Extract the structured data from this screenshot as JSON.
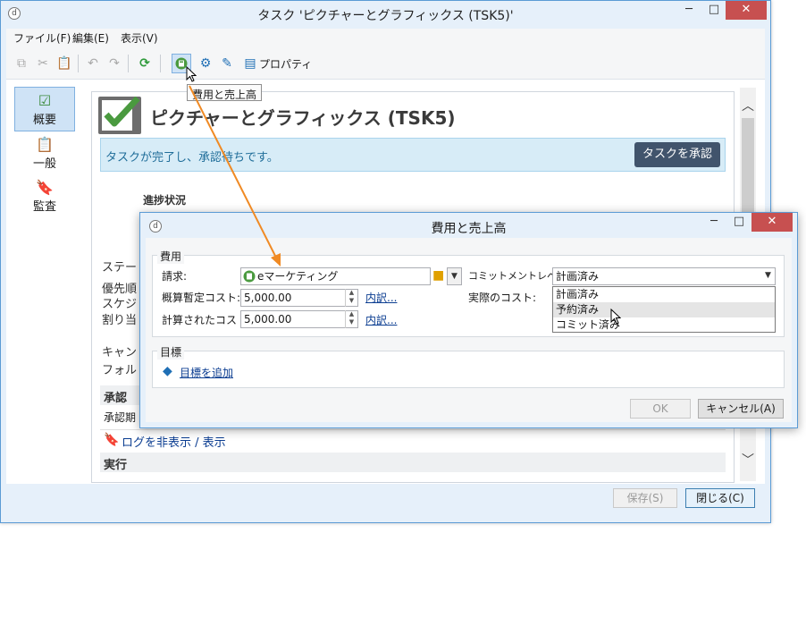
{
  "main_window": {
    "title": "タスク 'ピクチャーとグラフィックス (TSK5)'",
    "app_icon": "d",
    "window_buttons": {
      "minimize": "─",
      "maximize": "□",
      "close": "✕"
    }
  },
  "menu": {
    "items": [
      "ファイル(F)",
      "編集(E)",
      "表示(V)"
    ]
  },
  "toolbar": {
    "properties_label": "プロパティ",
    "tooltip": "費用と売上高"
  },
  "sidebar": {
    "items": [
      {
        "label": "概要",
        "icon": "checklist-icon"
      },
      {
        "label": "一般",
        "icon": "clipboard-icon"
      },
      {
        "label": "監査",
        "icon": "audit-icon"
      }
    ]
  },
  "content": {
    "title": "ピクチャーとグラフィックス (TSK5)",
    "info_message": "タスクが完了し、承認待ちです。",
    "approve_button": "タスクを承認",
    "progress_label": "進捗状況",
    "left_labels": [
      "ステー",
      "優先順",
      "スケジ",
      "割り当"
    ],
    "left_labels_2": [
      "キャン",
      "フォル"
    ],
    "section_approval": "承認",
    "approval_period_label": "承認期",
    "log_link": "ログを非表示 / 表示",
    "section_execution": "実行"
  },
  "footer": {
    "save_button": "保存(S)",
    "close_button": "閉じる(C)"
  },
  "dialog": {
    "title": "費用と売上高",
    "app_icon": "d",
    "cost_group": {
      "label": "費用",
      "billing_label": "請求:",
      "billing_value": "eマーケティング",
      "estimate_label": "概算暫定コスト:",
      "estimate_value": "5,000.00",
      "estimate_detail_link": "内訳...",
      "calculated_label": "計算されたコスト:",
      "calculated_value": "5,000.00",
      "calculated_detail_link": "内訳...",
      "commitment_label": "コミットメントレベル:",
      "commitment_value": "計画済み",
      "actual_cost_label": "実際のコスト:",
      "commitment_options": [
        "計画済み",
        "予約済み",
        "コミット済み"
      ]
    },
    "goals_group": {
      "label": "目標",
      "add_goal_link": "目標を追加"
    },
    "ok_button": "OK",
    "cancel_button": "キャンセル(A)"
  },
  "colors": {
    "window_border": "#5b9bd5",
    "accent_green": "#4a9a3f",
    "approve_button_bg": "#41546c",
    "info_bar_bg": "#d7ecf7",
    "arrow_orange": "#f08a24",
    "close_button_red": "#c75050"
  }
}
